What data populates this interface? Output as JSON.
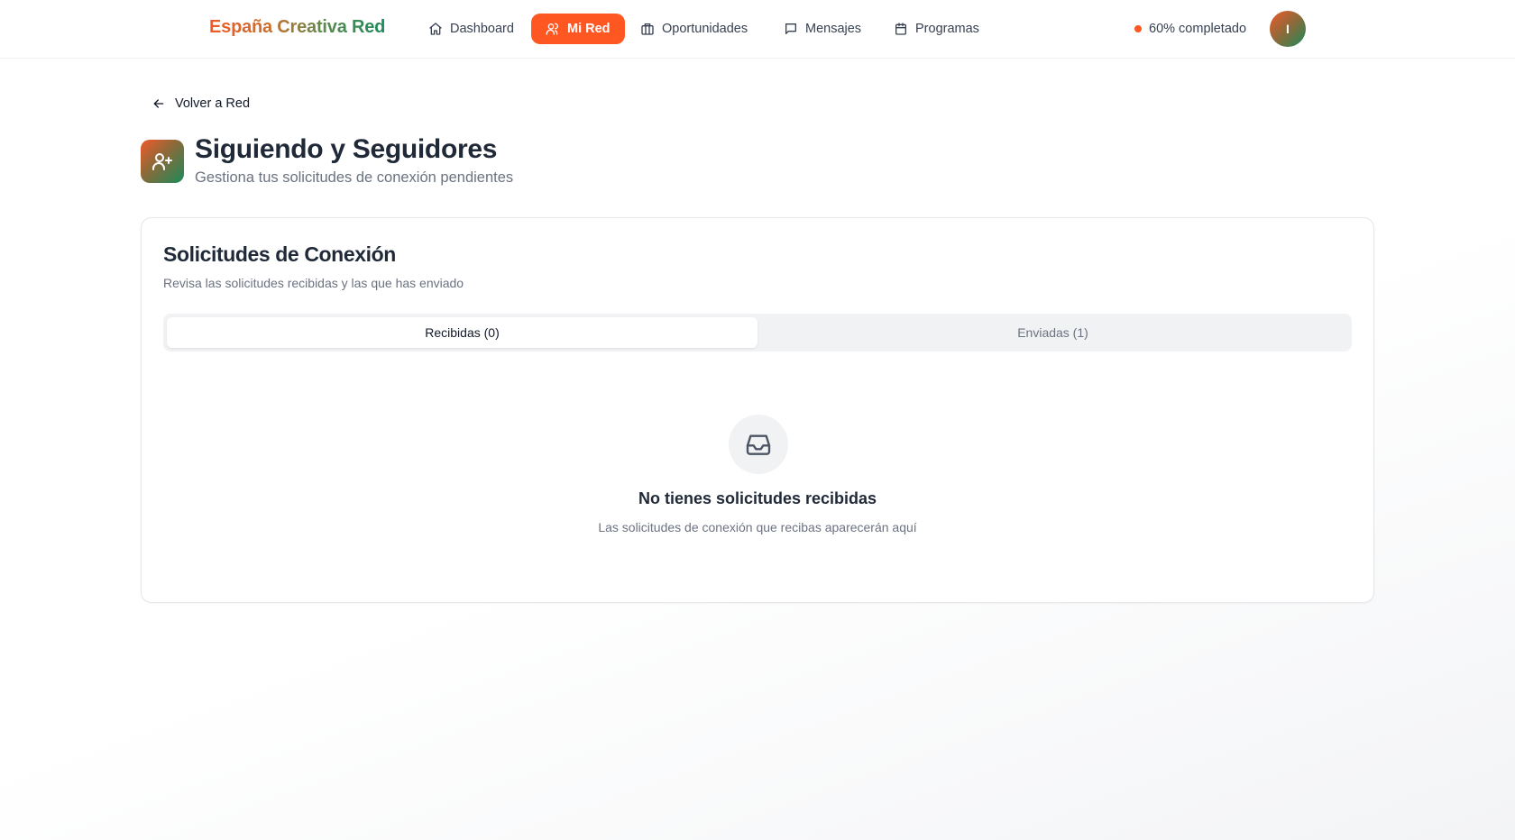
{
  "header": {
    "brand": "España Creativa Red",
    "nav": [
      {
        "label": "Dashboard",
        "icon": "home-icon",
        "active": false
      },
      {
        "label": "Mi Red",
        "icon": "users-icon",
        "active": true
      },
      {
        "label": "Oportunidades",
        "icon": "briefcase-icon",
        "active": false
      },
      {
        "label": "Mensajes",
        "icon": "message-square-icon",
        "active": false
      },
      {
        "label": "Programas",
        "icon": "calendar-icon",
        "active": false
      }
    ],
    "profile_progress": "60% completado",
    "avatar_initial": "I"
  },
  "page": {
    "back_label": "Volver a Red",
    "title": "Siguiendo y Seguidores",
    "subtitle": "Gestiona tus solicitudes de conexión pendientes",
    "title_icon": "user-plus-icon"
  },
  "card": {
    "title": "Solicitudes de Conexión",
    "description": "Revisa las solicitudes recibidas y las que has enviado",
    "tabs": [
      {
        "label": "Recibidas (0)",
        "active": true
      },
      {
        "label": "Enviadas (1)",
        "active": false
      }
    ],
    "empty_state": {
      "icon": "inbox-icon",
      "title": "No tienes solicitudes recibidas",
      "description": "Las solicitudes de conexión que recibas aparecerán aquí"
    }
  },
  "colors": {
    "accent": "#ff5722",
    "brand_start": "#f05a28",
    "brand_end": "#1b8a5a"
  }
}
